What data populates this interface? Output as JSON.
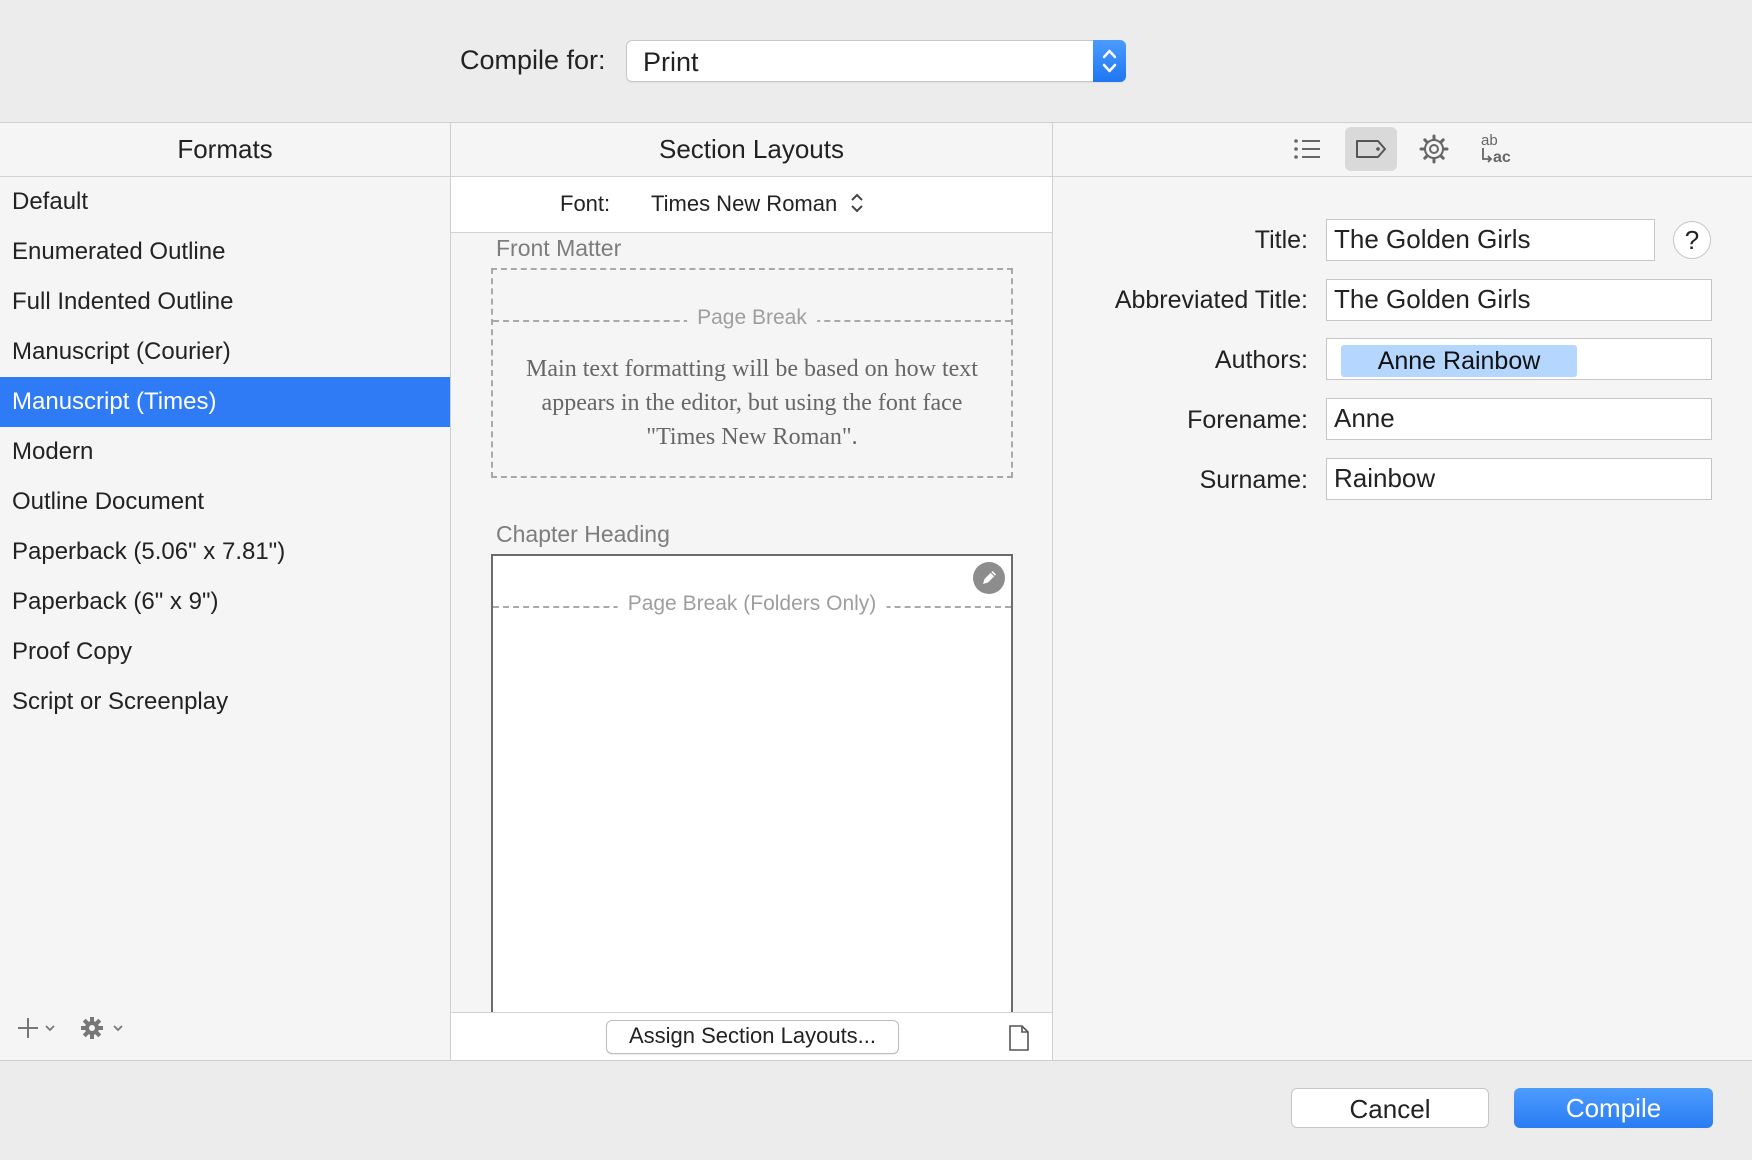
{
  "compile_for": {
    "label": "Compile for:",
    "value": "Print"
  },
  "formats": {
    "header": "Formats",
    "items": [
      {
        "label": "Default"
      },
      {
        "label": "Enumerated Outline"
      },
      {
        "label": "Full Indented Outline"
      },
      {
        "label": "Manuscript (Courier)"
      },
      {
        "label": "Manuscript (Times)",
        "selected": true
      },
      {
        "label": "Modern"
      },
      {
        "label": "Outline Document"
      },
      {
        "label": "Paperback (5.06\" x 7.81\")"
      },
      {
        "label": "Paperback (6\" x 9\")"
      },
      {
        "label": "Proof Copy"
      },
      {
        "label": "Script or Screenplay"
      }
    ]
  },
  "section_layouts": {
    "header": "Section Layouts",
    "font_label": "Font:",
    "font_value": "Times New Roman",
    "front_matter": {
      "title": "Front Matter",
      "page_break": "Page Break",
      "description": "Main text formatting will be based on how text appears in the editor, but using the font face \"Times New Roman\"."
    },
    "chapter_heading": {
      "title": "Chapter Heading",
      "page_break": "Page Break (Folders Only)"
    },
    "assign_button": "Assign Section Layouts..."
  },
  "metadata": {
    "title_label": "Title:",
    "title_value": "The Golden Girls",
    "abbrev_label": "Abbreviated Title:",
    "abbrev_value": "The Golden Girls",
    "authors_label": "Authors:",
    "author_token": "Anne Rainbow",
    "forename_label": "Forename:",
    "forename_value": "Anne",
    "surname_label": "Surname:",
    "surname_value": "Rainbow",
    "help": "?",
    "toolbar_icons": [
      "list-icon",
      "tag-icon",
      "gear-icon",
      "replacements-icon"
    ],
    "replacements_icon_text": {
      "top": "ab",
      "bottom": "ac"
    }
  },
  "footer": {
    "cancel": "Cancel",
    "compile": "Compile"
  },
  "colors": {
    "accent": "#2f7bf5",
    "token": "#b4d6ff"
  }
}
